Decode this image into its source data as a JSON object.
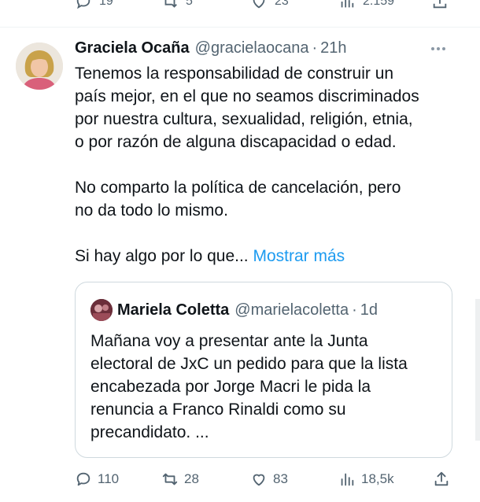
{
  "previous_tweet": {
    "actions": [
      {
        "icon": "reply-icon",
        "count": "19"
      },
      {
        "icon": "retweet-icon",
        "count": "5"
      },
      {
        "icon": "like-icon",
        "count": "23"
      },
      {
        "icon": "views-icon",
        "count": "2.159"
      },
      {
        "icon": "share-icon",
        "count": ""
      }
    ]
  },
  "tweet": {
    "author_name": "Graciela Ocaña",
    "handle": "@gracielaocana",
    "separator": "·",
    "time": "21h",
    "lines_p1": [
      "Tenemos la responsabilidad de construir un",
      "país mejor, en el que no seamos discriminados",
      "por nuestra cultura, sexualidad, religión, etnia,",
      "o por razón de alguna discapacidad o edad."
    ],
    "lines_p2": [
      "No comparto la política de cancelación, pero",
      "no da todo lo mismo."
    ],
    "truncated_text": "Si hay algo por lo que...",
    "show_more": "Mostrar más",
    "actions": {
      "reply": "110",
      "retweet": "28",
      "like": "83",
      "views": "18,5k"
    }
  },
  "quote": {
    "author_name": "Mariela Coletta",
    "handle": "@marielacoletta",
    "separator": "·",
    "time": "1d",
    "lines": [
      "Mañana voy a presentar ante la Junta",
      "electoral de JxC un pedido para que la lista",
      "encabezada por Jorge Macri le pida la",
      "renuncia a Franco Rinaldi como su",
      "precandidato. ..."
    ]
  },
  "colors": {
    "text": "#0f1419",
    "secondary": "#536471",
    "link": "#1d9bf0",
    "border": "#cfd9de"
  }
}
